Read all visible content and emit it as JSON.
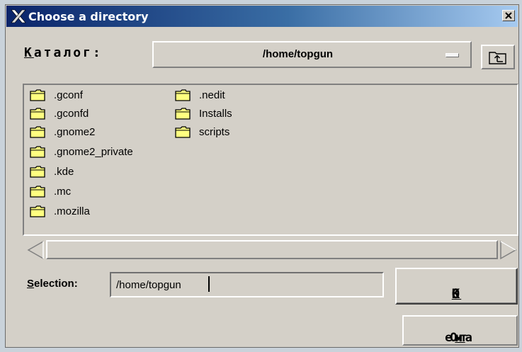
{
  "window": {
    "title": "Choose a directory",
    "title_icon": "x-logo-icon",
    "close_icon": "close-icon"
  },
  "directory": {
    "label_mnemonic": "К",
    "label_rest": "аталог:",
    "current_path": "/home/topgun",
    "combo_icon": "dropdown-indicator-icon",
    "up_button_icon": "folder-up-icon"
  },
  "file_list": {
    "folder_icon": "folder-icon",
    "items": [
      ".gconf",
      ".gconfd",
      ".gnome2",
      ".gnome2_private",
      ".kde",
      ".mc",
      ".mozilla",
      ".nedit",
      "Installs",
      "scripts"
    ]
  },
  "scrollbar": {
    "left_icon": "scroll-left-arrow-icon",
    "right_icon": "scroll-right-arrow-icon"
  },
  "selection": {
    "label_mnemonic": "S",
    "label_rest": "election:",
    "value": "/home/topgun"
  },
  "buttons": {
    "ok_mnemonic": "O",
    "ok_rest": "K",
    "cancel_pre": "От",
    "cancel_mnemonic": "м",
    "cancel_post": "ена"
  },
  "colors": {
    "dialog_bg": "#d4d0c8",
    "titlebar_start": "#0a246a",
    "titlebar_end": "#a6caf0",
    "folder_fill": "#ffff80"
  }
}
